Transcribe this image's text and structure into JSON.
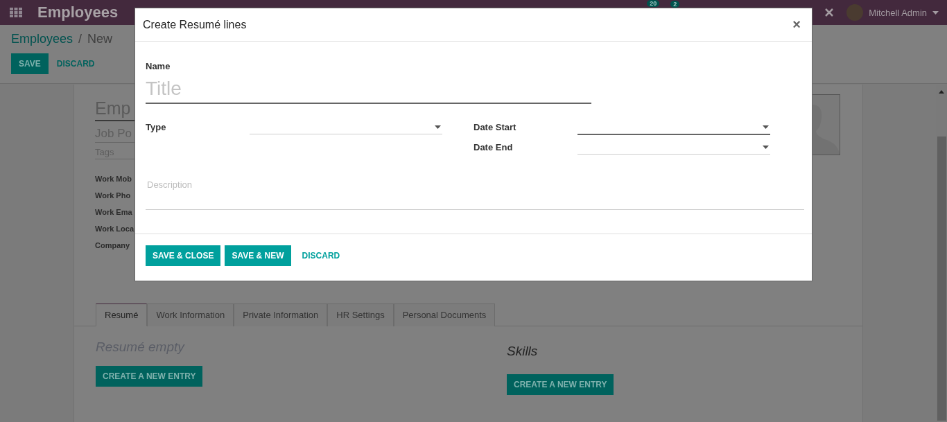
{
  "navbar": {
    "app_title": "Employees",
    "activity_count": "20",
    "message_count": "2",
    "user": "Mitchell Admin"
  },
  "breadcrumb": {
    "parent": "Employees",
    "separator": "/",
    "current": "New"
  },
  "control_buttons": [
    {
      "label": "SAVE",
      "kind": "primary"
    },
    {
      "label": "DISCARD",
      "kind": "link"
    }
  ],
  "employee_form": {
    "name_placeholder": "Emp",
    "job_placeholder": "Job Po",
    "tags_placeholder": "Tags",
    "fields": [
      "Work Mob",
      "Work Pho",
      "Work Ema",
      "Work Loca",
      "Company"
    ],
    "tabs": [
      {
        "label": "Resumé",
        "selected": true
      },
      {
        "label": "Work Information",
        "selected": false
      },
      {
        "label": "Private Information",
        "selected": false
      },
      {
        "label": "HR Settings",
        "selected": false
      },
      {
        "label": "Personal Documents",
        "selected": false
      }
    ],
    "resume_empty": "Resumé empty",
    "resume_button": "CREATE A NEW ENTRY",
    "skills_title": "Skills",
    "skills_button": "CREATE A NEW ENTRY"
  },
  "dialog": {
    "title": "Create Resumé lines",
    "close": "×",
    "name_label": "Name",
    "name_placeholder": "Title",
    "left_fields": [
      {
        "label": "Type",
        "focused": false
      }
    ],
    "right_fields": [
      {
        "label": "Date Start",
        "focused": true
      },
      {
        "label": "Date End",
        "focused": false
      }
    ],
    "description_placeholder": "Description",
    "buttons": [
      {
        "label": "SAVE & CLOSE",
        "kind": "primary"
      },
      {
        "label": "SAVE & NEW",
        "kind": "primary"
      },
      {
        "label": "DISCARD",
        "kind": "link"
      }
    ]
  }
}
